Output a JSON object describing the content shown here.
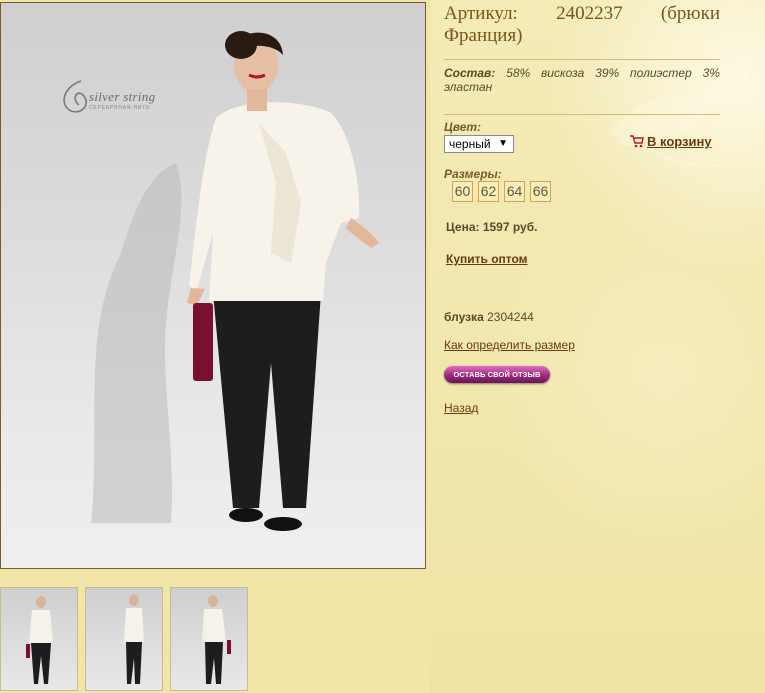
{
  "product": {
    "title": "Артикул: 2402237 (брюки Франция)",
    "composition_label": "Состав:",
    "composition_value": "58% вискоза 39% полиэстер 3% эластан",
    "brand_name": "silver string",
    "brand_tagline": "СЕРЕБРЯНАЯ НИТЬ"
  },
  "options": {
    "color_label": "Цвет:",
    "color_selected": "черный",
    "sizes_label": "Размеры:",
    "sizes": [
      "60",
      "62",
      "64",
      "66"
    ]
  },
  "actions": {
    "cart_label": "В корзину",
    "price_text": "Цена: 1597 руб.",
    "wholesale_label": "Купить оптом",
    "related_label": "блузка",
    "related_code": "2304244",
    "size_help_label": "Как определить размер",
    "review_label": "ОСТАВЬ СВОЙ ОТЗЫВ",
    "back_label": "Назад"
  },
  "colors": {
    "page_background": "#f1e6a8",
    "link": "#6a3a10",
    "size_border": "#e0a04a",
    "review_button": "#a02880"
  },
  "icons": [
    "cart-icon",
    "chevron-down-icon",
    "brand-logo"
  ]
}
